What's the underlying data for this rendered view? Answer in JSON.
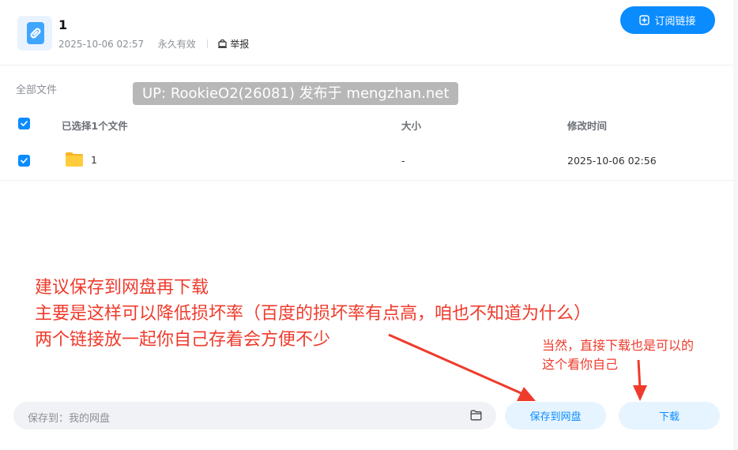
{
  "header": {
    "title": "1",
    "date": "2025-10-06 02:57",
    "validity": "永久有效",
    "report": "举报",
    "subscribe_label": "订阅链接"
  },
  "breadcrumb": "全部文件",
  "watermark": "UP: RookieO2(26081) 发布于 mengzhan.net",
  "table": {
    "headers": {
      "name": "已选择1个文件",
      "size": "大小",
      "modified": "修改时间"
    },
    "rows": [
      {
        "name": "1",
        "size": "-",
        "modified": "2025-10-06 02:56",
        "checked": true
      }
    ]
  },
  "annotations": {
    "line1": "建议保存到网盘再下载",
    "line2": "主要是这样可以降低损坏率（百度的损坏率有点高，咱也不知道为什么）",
    "line3": "两个链接放一起你自己存着会方便不少",
    "small1": "当然，直接下载也是可以的",
    "small2": "这个看你自己"
  },
  "bottom": {
    "save_path_label": "保存到：我的网盘",
    "save_button": "保存到网盘",
    "download_button": "下载"
  },
  "colors": {
    "accent": "#0a8cff",
    "annotation": "#ef3b2c",
    "watermark_bg": "#b7b7b7"
  }
}
